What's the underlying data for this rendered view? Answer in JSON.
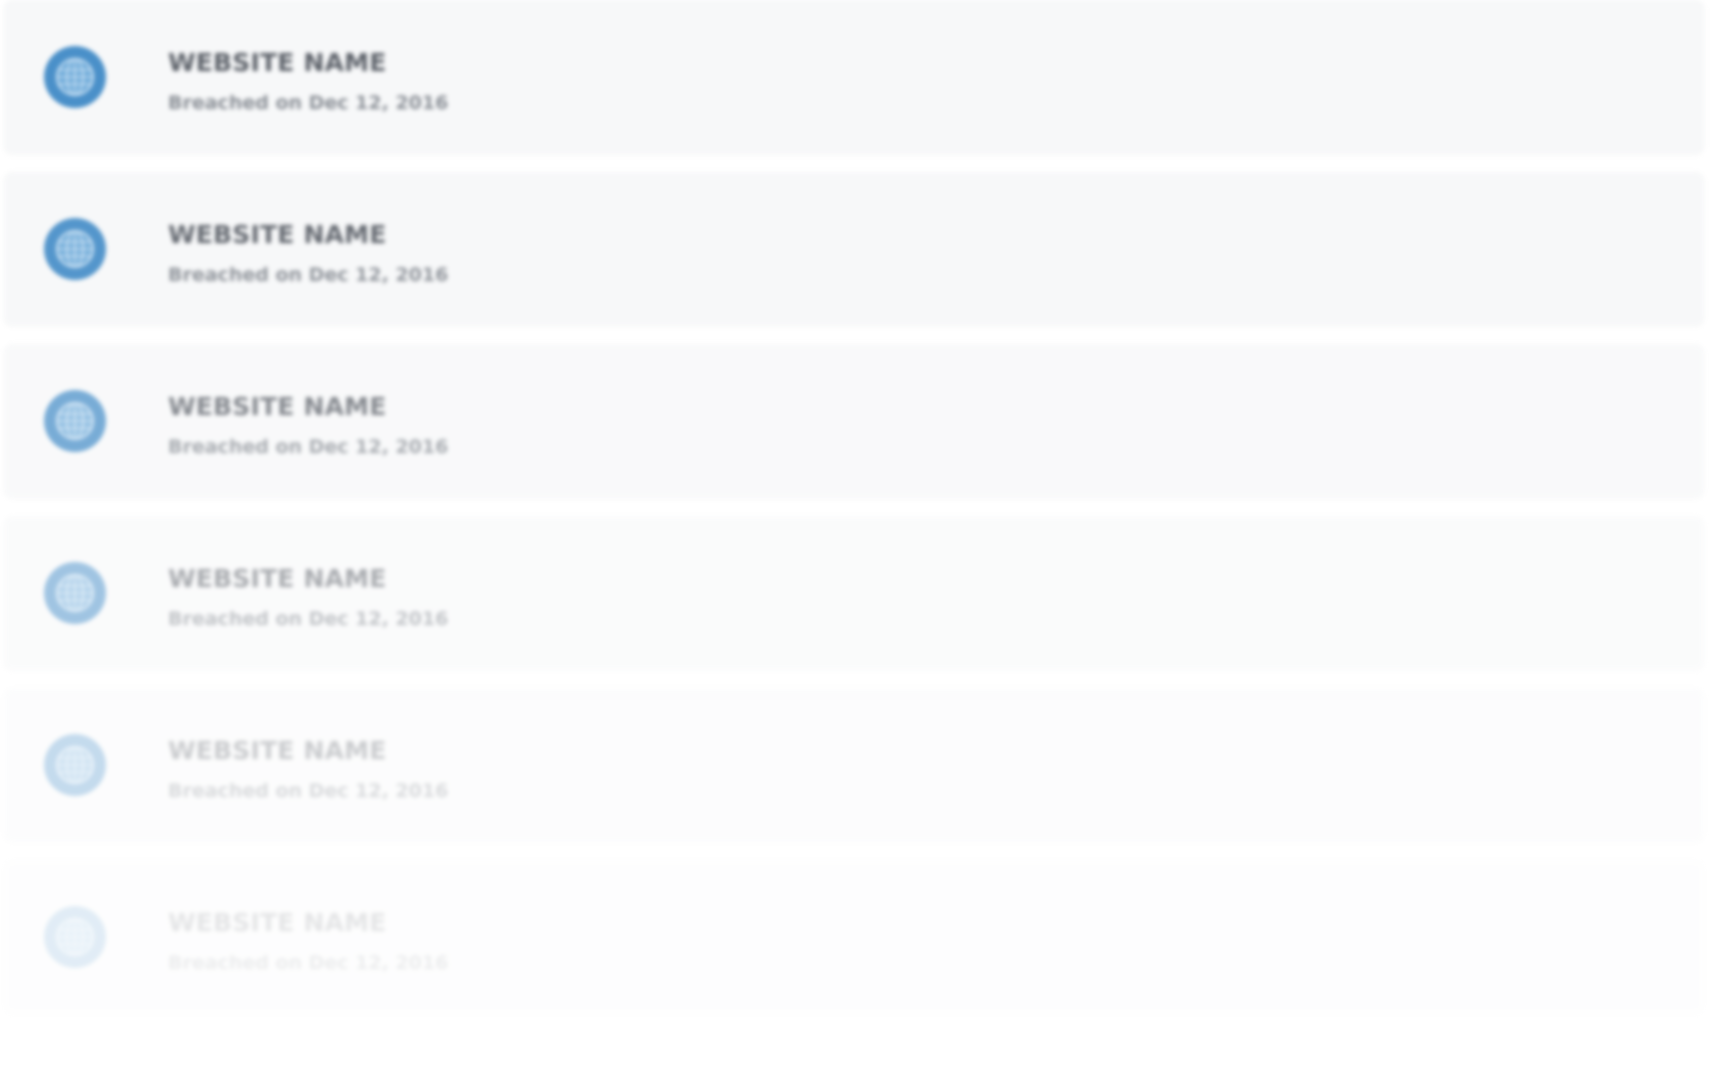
{
  "accent_color": "#4a90c9",
  "breaches": [
    {
      "icon": "globe-icon",
      "name": "WEBSITE NAME",
      "breached_on": "Breached on Dec 12, 2016"
    },
    {
      "icon": "globe-icon",
      "name": "WEBSITE NAME",
      "breached_on": "Breached on Dec 12, 2016"
    },
    {
      "icon": "globe-icon",
      "name": "WEBSITE NAME",
      "breached_on": "Breached on Dec 12, 2016"
    },
    {
      "icon": "globe-icon",
      "name": "WEBSITE NAME",
      "breached_on": "Breached on Dec 12, 2016"
    },
    {
      "icon": "globe-icon",
      "name": "WEBSITE NAME",
      "breached_on": "Breached on Dec 12, 2016"
    },
    {
      "icon": "globe-icon",
      "name": "WEBSITE NAME",
      "breached_on": "Breached on Dec 12, 2016"
    }
  ]
}
